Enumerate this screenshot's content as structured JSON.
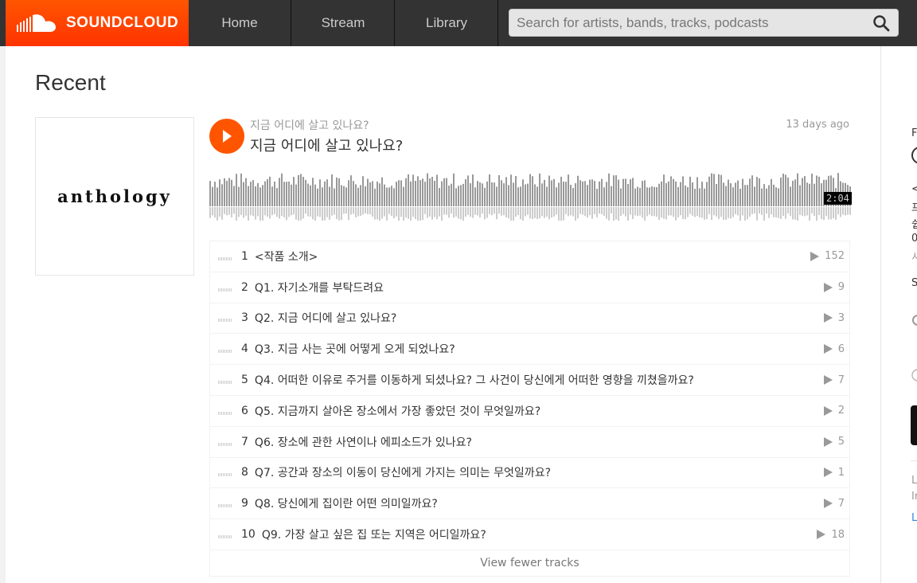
{
  "header": {
    "logo_text": "SOUNDCLOUD",
    "nav": [
      "Home",
      "Stream",
      "Library"
    ],
    "search_placeholder": "Search for artists, bands, tracks, podcasts"
  },
  "colors": {
    "accent": "#ff5500",
    "topbar": "#333333"
  },
  "page": {
    "title": "Recent"
  },
  "playlist": {
    "artwork_text": "anthology",
    "uploader": "지금 어디에 살고 있나요?",
    "title": "지금 어디에 살고 있나요?",
    "posted": "13 days ago",
    "duration": "2:04",
    "tracks": [
      {
        "num": "1",
        "title": "<작품 소개>",
        "plays": "152"
      },
      {
        "num": "2",
        "title": "Q1. 자기소개를 부탁드려요",
        "plays": "9"
      },
      {
        "num": "3",
        "title": "Q2. 지금 어디에 살고 있나요?",
        "plays": "3"
      },
      {
        "num": "4",
        "title": "Q3. 지금 사는 곳에 어떻게 오게 되었나요?",
        "plays": "6"
      },
      {
        "num": "5",
        "title": "Q4. 어떠한 이유로 주거를 이동하게 되셨나요? 그 사건이 당신에게 어떠한 영향을 끼쳤을까요?",
        "plays": "7"
      },
      {
        "num": "6",
        "title": "Q5. 지금까지 살아온 장소에서 가장 좋았던 것이 무엇일까요?",
        "plays": "2"
      },
      {
        "num": "7",
        "title": "Q6. 장소에 관한 사연이나 에피소드가 있나요?",
        "plays": "5"
      },
      {
        "num": "8",
        "title": "Q7. 공간과 장소의 이동이 당신에게 가지는 의미는 무엇일까요?",
        "plays": "1"
      },
      {
        "num": "9",
        "title": "Q8. 당신에게 집이란 어떤 의미일까요?",
        "plays": "7"
      },
      {
        "num": "10",
        "title": "Q9. 가장 살고 싶은 집 또는 지역은 어디일까요?",
        "plays": "18"
      }
    ],
    "view_fewer_label": "View fewer tracks"
  },
  "sidebar_fragments": [
    "F",
    "<",
    "프",
    "쉽",
    "0",
    "시",
    "S",
    "L",
    "Ir",
    "L"
  ]
}
